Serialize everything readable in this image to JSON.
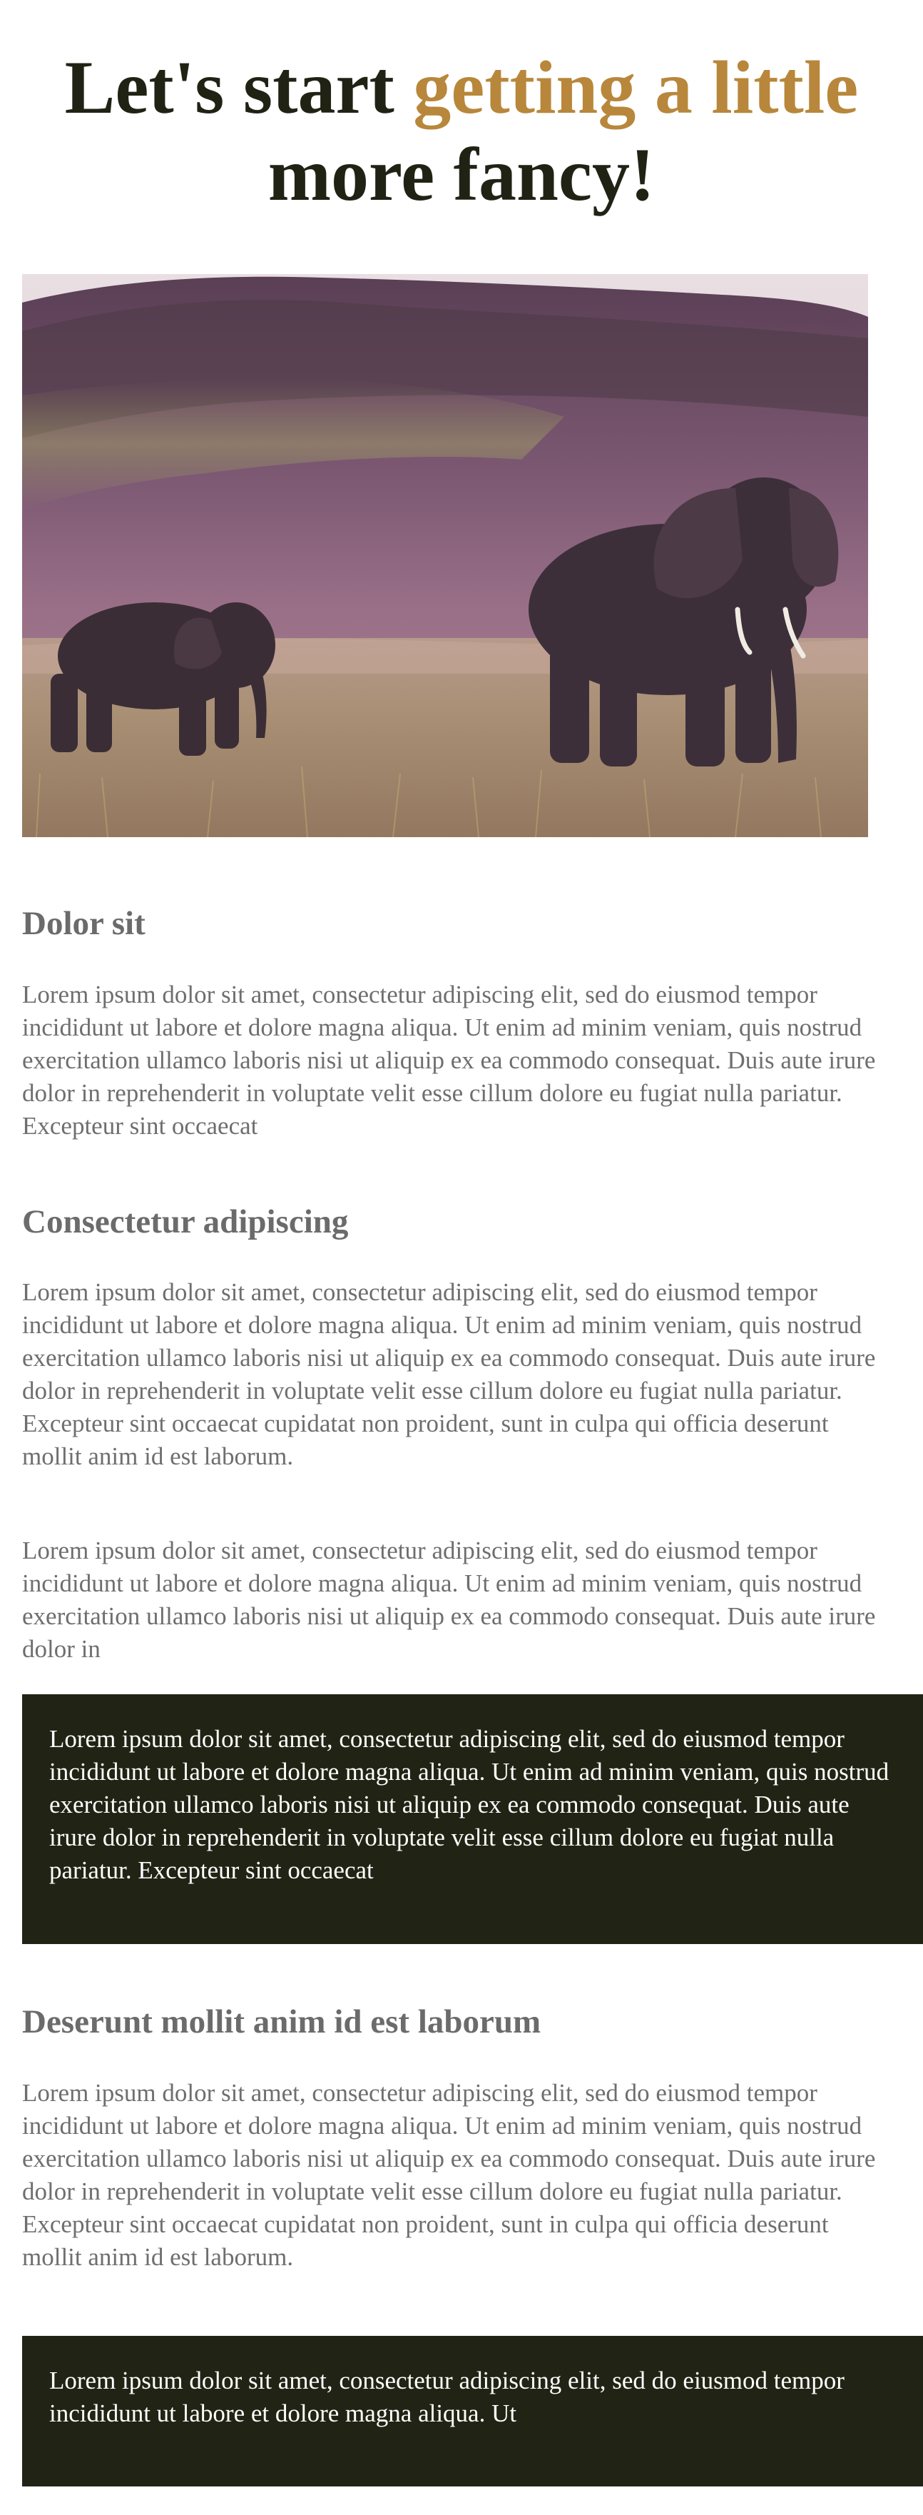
{
  "hero": {
    "title_part1": "Let's start ",
    "title_accent": "getting a little",
    "title_part2": "more fancy!",
    "accent_color": "#b8873b",
    "image_icon": "elephants-photo"
  },
  "sections": [
    {
      "heading": "Dolor sit",
      "paragraphs": [
        "Lorem ipsum dolor sit amet, consectetur adipiscing elit, sed do eiusmod tempor incididunt ut labore et dolore magna aliqua. Ut enim ad minim veniam, quis nostrud exercitation ullamco laboris nisi ut aliquip ex ea commodo consequat. Duis aute irure dolor in reprehenderit in voluptate velit esse cillum dolore eu fugiat nulla pariatur. Excepteur sint occaecat"
      ]
    },
    {
      "heading": "Consectetur adipiscing",
      "paragraphs": [
        "Lorem ipsum dolor sit amet, consectetur adipiscing elit, sed do eiusmod tempor incididunt ut labore et dolore magna aliqua. Ut enim ad minim veniam, quis nostrud exercitation ullamco laboris nisi ut aliquip ex ea commodo consequat. Duis aute irure dolor in reprehenderit in voluptate velit esse cillum dolore eu fugiat nulla pariatur. Excepteur sint occaecat cupidatat non proident, sunt in culpa qui officia deserunt mollit anim id est laborum.",
        "Lorem ipsum dolor sit amet, consectetur adipiscing elit, sed do eiusmod tempor incididunt ut labore et dolore magna aliqua. Ut enim ad minim veniam, quis nostrud exercitation ullamco laboris nisi ut aliquip ex ea commodo consequat. Duis aute irure dolor in"
      ],
      "callout": "Lorem ipsum dolor sit amet, consectetur adipiscing elit, sed do eiusmod tempor incididunt ut labore et dolore magna aliqua. Ut enim ad minim veniam, quis nostrud exercitation ullamco laboris nisi ut aliquip ex ea commodo consequat. Duis aute irure dolor in reprehenderit in voluptate velit esse cillum dolore eu fugiat nulla pariatur. Excepteur sint occaecat"
    },
    {
      "heading": "Deserunt mollit anim id est laborum",
      "paragraphs": [
        "Lorem ipsum dolor sit amet, consectetur adipiscing elit, sed do eiusmod tempor incididunt ut labore et dolore magna aliqua. Ut enim ad minim veniam, quis nostrud exercitation ullamco laboris nisi ut aliquip ex ea commodo consequat. Duis aute irure dolor in reprehenderit in voluptate velit esse cillum dolore eu fugiat nulla pariatur. Excepteur sint occaecat cupidatat non proident, sunt in culpa qui officia deserunt mollit anim id est laborum."
      ],
      "callout": "Lorem ipsum dolor sit amet, consectetur adipiscing elit, sed do eiusmod tempor incididunt ut labore et dolore magna aliqua. Ut"
    }
  ],
  "colors": {
    "heading_dark": "#202314",
    "callout_bg": "#212414",
    "body_text": "#6e6e6e"
  }
}
